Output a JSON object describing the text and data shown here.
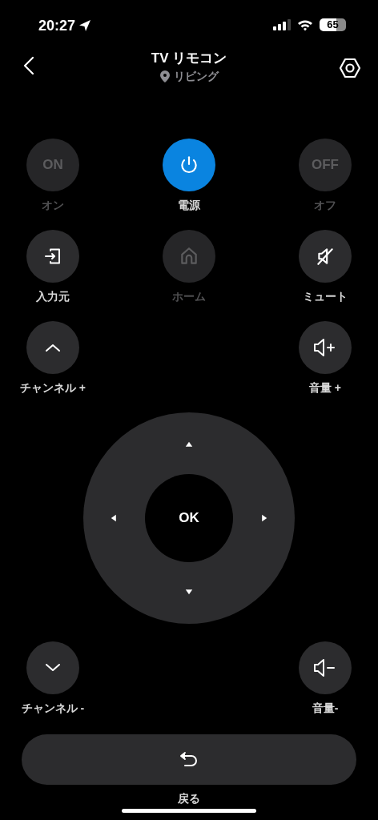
{
  "status_bar": {
    "time": "20:27",
    "battery": "65"
  },
  "header": {
    "title": "TV リモコン",
    "location": "リビング"
  },
  "rows": [
    {
      "left": {
        "label": "オン",
        "kind": "text",
        "glyph": "ON",
        "disabled": true,
        "active": false
      },
      "center": {
        "label": "電源",
        "kind": "icon",
        "disabled": false,
        "active": true
      },
      "right": {
        "label": "オフ",
        "kind": "text",
        "glyph": "OFF",
        "disabled": true,
        "active": false
      }
    },
    {
      "left": {
        "label": "入力元",
        "kind": "icon",
        "disabled": false,
        "active": false
      },
      "center": {
        "label": "ホーム",
        "kind": "icon",
        "disabled": true,
        "active": false
      },
      "right": {
        "label": "ミュート",
        "kind": "icon",
        "disabled": false,
        "active": false
      }
    },
    {
      "left": {
        "label": "チャンネル +",
        "kind": "icon",
        "disabled": false,
        "active": false
      },
      "right": {
        "label": "音量 +",
        "kind": "icon",
        "disabled": false,
        "active": false
      }
    }
  ],
  "dpad": {
    "ok": "OK"
  },
  "bottom_row": {
    "left": {
      "label": "チャンネル -",
      "kind": "icon",
      "disabled": false,
      "active": false
    },
    "right": {
      "label": "音量-",
      "kind": "icon",
      "disabled": false,
      "active": false
    }
  },
  "back_button": {
    "label": "戻る"
  }
}
